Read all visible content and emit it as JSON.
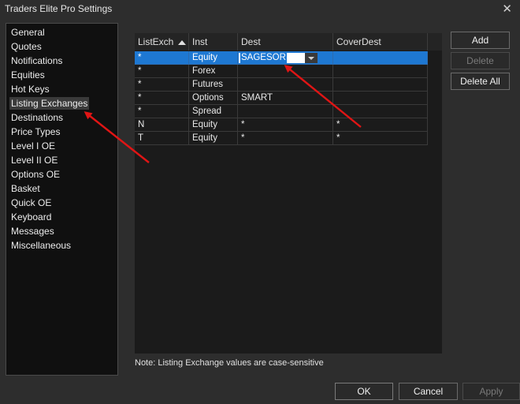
{
  "window": {
    "title": "Traders Elite Pro Settings",
    "close_glyph": "✕"
  },
  "sidebar": {
    "items": [
      {
        "label": "General"
      },
      {
        "label": "Quotes"
      },
      {
        "label": "Notifications"
      },
      {
        "label": "Equities"
      },
      {
        "label": "Hot Keys"
      },
      {
        "label": "Listing Exchanges",
        "selected": true
      },
      {
        "label": "Destinations"
      },
      {
        "label": "Price Types"
      },
      {
        "label": "Level I OE"
      },
      {
        "label": "Level II OE"
      },
      {
        "label": "Options OE"
      },
      {
        "label": "Basket"
      },
      {
        "label": "Quick OE"
      },
      {
        "label": "Keyboard"
      },
      {
        "label": "Messages"
      },
      {
        "label": "Miscellaneous"
      }
    ]
  },
  "grid": {
    "columns": [
      "ListExch",
      "Inst",
      "Dest",
      "CoverDest"
    ],
    "sorted_column": "ListExch",
    "rows": [
      {
        "ListExch": "*",
        "Inst": "Equity",
        "Dest": "SAGESOR",
        "CoverDest": "",
        "selected": true,
        "editing": true
      },
      {
        "ListExch": "*",
        "Inst": "Forex",
        "Dest": "",
        "CoverDest": ""
      },
      {
        "ListExch": "*",
        "Inst": "Futures",
        "Dest": "",
        "CoverDest": ""
      },
      {
        "ListExch": "*",
        "Inst": "Options",
        "Dest": "SMART",
        "CoverDest": ""
      },
      {
        "ListExch": "*",
        "Inst": "Spread",
        "Dest": "",
        "CoverDest": ""
      },
      {
        "ListExch": "N",
        "Inst": "Equity",
        "Dest": "*",
        "CoverDest": "*"
      },
      {
        "ListExch": "T",
        "Inst": "Equity",
        "Dest": "*",
        "CoverDest": "*"
      }
    ]
  },
  "side_buttons": {
    "add": "Add",
    "delete": "Delete",
    "delete_all": "Delete All"
  },
  "note": "Note:  Listing Exchange values are case-sensitive",
  "footer_buttons": {
    "ok": "OK",
    "cancel": "Cancel",
    "apply": "Apply"
  },
  "colors": {
    "background": "#2d2d2d",
    "panel": "#101010",
    "selection": "#1e78d2",
    "annotation_arrow": "#e01515"
  },
  "icons": [
    "close-icon",
    "sort-ascending-icon",
    "dropdown-caret-icon",
    "annotation-arrow-icon"
  ]
}
